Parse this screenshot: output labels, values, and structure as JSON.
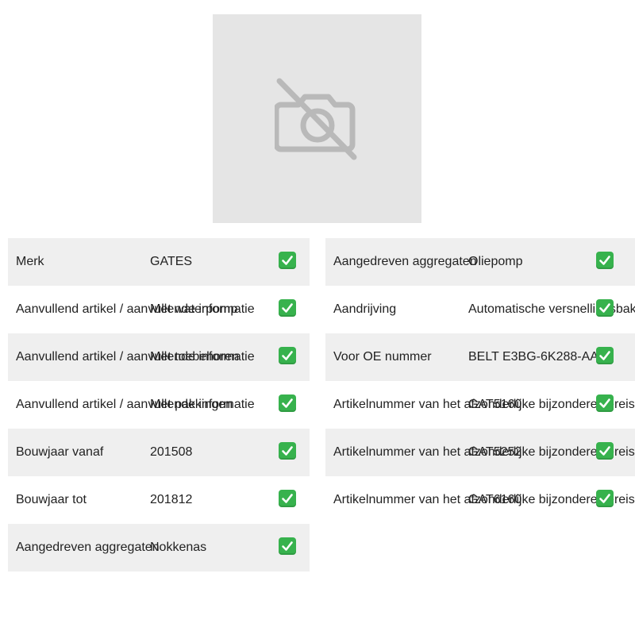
{
  "image": {
    "icon": "no-photo-camera-icon",
    "background": "#e5e5e5"
  },
  "colors": {
    "row_shade": "#efefef",
    "check": "#37b24d"
  },
  "left_rows": [
    {
      "label": "Merk",
      "value": "GATES",
      "icon": "check-icon"
    },
    {
      "label": "Aanvullend artikel / aanvullende informatie",
      "value": "Met waterpomp",
      "icon": "check-icon"
    },
    {
      "label": "Aanvullend artikel / aanvullende informatie",
      "value": "Met toebehoren",
      "icon": "check-icon"
    },
    {
      "label": "Aanvullend artikel / aanvullende informatie",
      "value": "Met pakkingen",
      "icon": "check-icon"
    },
    {
      "label": "Bouwjaar vanaf",
      "value": "201508",
      "icon": "check-icon"
    },
    {
      "label": "Bouwjaar tot",
      "value": "201812",
      "icon": "check-icon"
    },
    {
      "label": "Aangedreven aggregaten",
      "value": "Nokkenas",
      "icon": "check-icon"
    }
  ],
  "right_rows": [
    {
      "label": "Aangedreven aggregaten",
      "value": "Oliepomp",
      "icon": "check-icon"
    },
    {
      "label": "Aandrijving",
      "value": "Automatische versnellingsbak",
      "icon": "check-icon"
    },
    {
      "label": "Voor OE nummer",
      "value": "BELT E3BG-6K288-AA",
      "icon": "check-icon"
    },
    {
      "label": "Artikelnummer van het afzonderlijke bijzondere vereiste",
      "value": "GAT5160",
      "icon": "check-icon"
    },
    {
      "label": "Artikelnummer van het afzonderlijke bijzondere vereiste",
      "value": "GAT5252",
      "icon": "check-icon"
    },
    {
      "label": "Artikelnummer van het afzonderlijke bijzondere vereiste",
      "value": "GAT6160",
      "icon": "check-icon"
    }
  ]
}
